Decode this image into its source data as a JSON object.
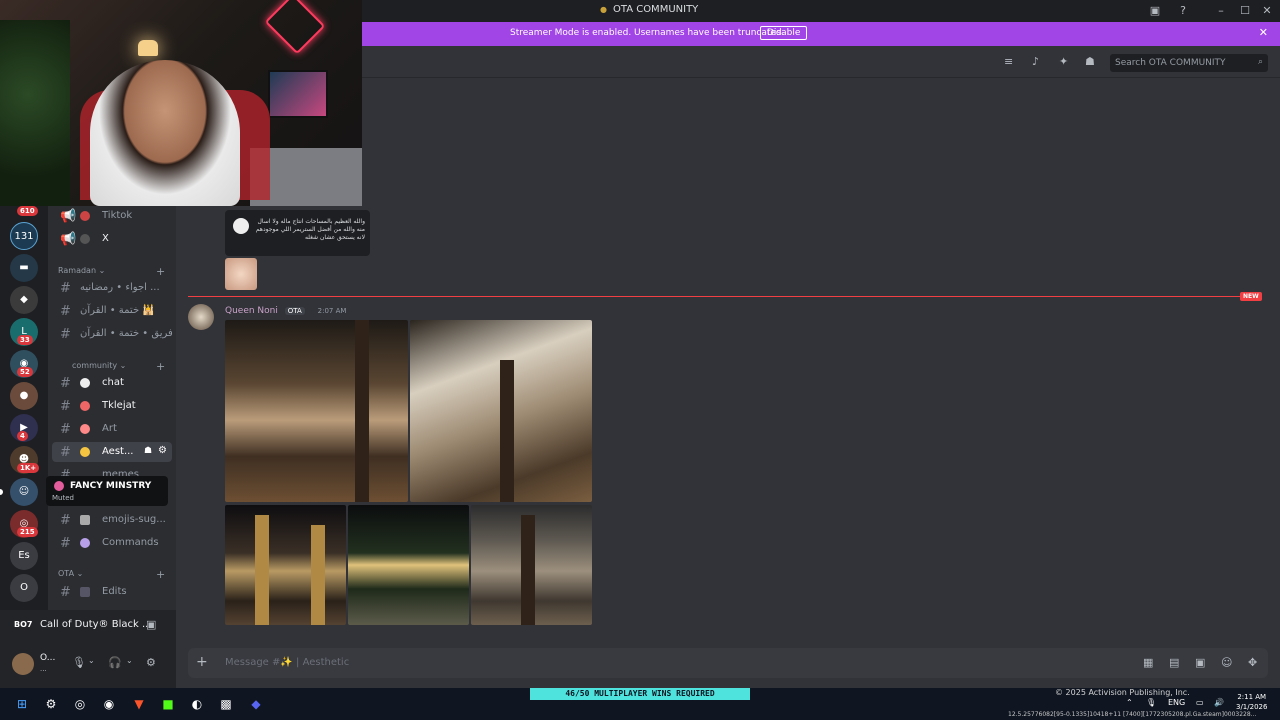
{
  "window": {
    "title": "OTA COMMUNITY"
  },
  "banner": {
    "text": "Streamer Mode is enabled. Usernames have been truncated.",
    "button": "Disable"
  },
  "search": {
    "placeholder": "Search OTA COMMUNITY"
  },
  "server_badges": [
    "610",
    "33",
    "52",
    "4",
    "1K+",
    "215"
  ],
  "server_letters": {
    "es": "Es",
    "o": "O"
  },
  "channels": {
    "top": [
      {
        "label": "Tiktok"
      },
      {
        "label": "X"
      }
    ],
    "ramadan": {
      "name": "Ramadan",
      "items": [
        "اجواء • رمضانيه ...",
        "ختمة • القرآن 🕌",
        "فريق • ختمة • القرآن..."
      ]
    },
    "community": {
      "name": "community",
      "items": [
        "chat",
        "Tklejat",
        "Art",
        "Aest...",
        "memes",
        "emojis-sug...",
        "Commands"
      ]
    },
    "ota": {
      "name": "OTA",
      "items": [
        "Edits"
      ]
    }
  },
  "tooltip": {
    "name": "FANCY MINSTRY",
    "status": "Muted"
  },
  "activity": {
    "game": "Call of Duty® Black ...",
    "icon": "BO7"
  },
  "user": {
    "name": "O...",
    "status": "..."
  },
  "message": {
    "author": "Queen Noni",
    "tag": "OTA",
    "time": "2:07 AM",
    "new_label": "NEW",
    "embed_snippet": "والله العظيم بالمساحات انتاج ماله ولا اسال منه والله من أفضل الستريمر اللي موجودهم لانه يستحق عشان شغله"
  },
  "composer": {
    "placeholder": "Message #✨ | Aesthetic"
  },
  "taskbar": {
    "game_status": "46/50 MULTIPLAYER WINS REQUIRED",
    "copyright": "© 2025 Activision Publishing, Inc.",
    "lang": "ENG",
    "time": "2:11 AM",
    "date": "3/1/2026",
    "build": "12.5.25776082[95-0.1335]10418+11 [7400][1772305208.pl.Ga.steam]0003228..."
  }
}
